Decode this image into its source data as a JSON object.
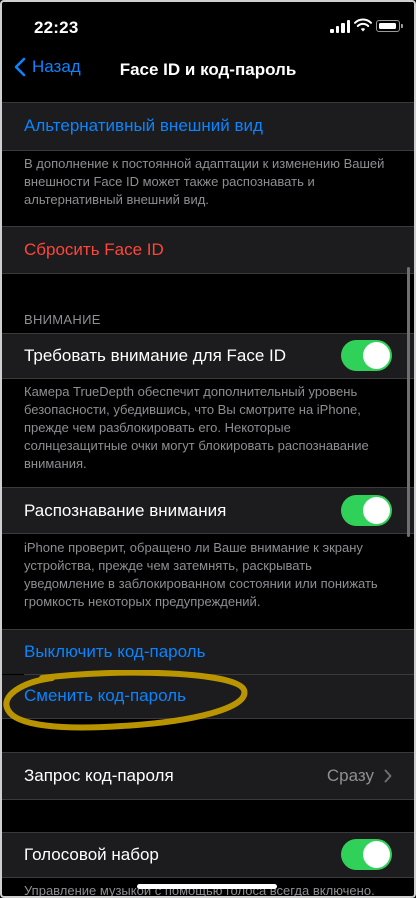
{
  "status_bar": {
    "time": "22:23"
  },
  "nav": {
    "back_label": "Назад",
    "title": "Face ID и код-пароль"
  },
  "alt_appearance": {
    "label": "Альтернативный внешний вид",
    "footer": "В дополнение к постоянной адаптации к изменению Вашей внешности Face ID может также распознавать и альтернативный внешний вид."
  },
  "reset_face_id": {
    "label": "Сбросить Face ID"
  },
  "attention_section": {
    "header": "ВНИМАНИЕ",
    "require_attention": {
      "label": "Требовать внимание для Face ID",
      "enabled": true,
      "footer": "Камера TrueDepth обеспечит дополнительный уровень безопасности, убедившись, что Вы смотрите на iPhone, прежде чем разблокировать его. Некоторые солнцезащитные очки могут блокировать распознавание внимания."
    },
    "attention_aware": {
      "label": "Распознавание внимания",
      "enabled": true,
      "footer": "iPhone проверит, обращено ли Ваше внимание к экрану устройства, прежде чем затемнять, раскрывать уведомление в заблокированном состоянии или понижать громкость некоторых предупреждений."
    }
  },
  "passcode": {
    "turn_off_label": "Выключить код-пароль",
    "change_label": "Сменить код-пароль"
  },
  "require_passcode": {
    "label": "Запрос код-пароля",
    "value": "Сразу"
  },
  "voice_dial": {
    "label": "Голосовой набор",
    "enabled": true,
    "footer": "Управление музыкой с помощью голоса всегда включено."
  },
  "colors": {
    "accent": "#0a84ff",
    "destructive": "#ff453a",
    "toggle_on": "#30d158",
    "annotation": "#c8a000"
  }
}
